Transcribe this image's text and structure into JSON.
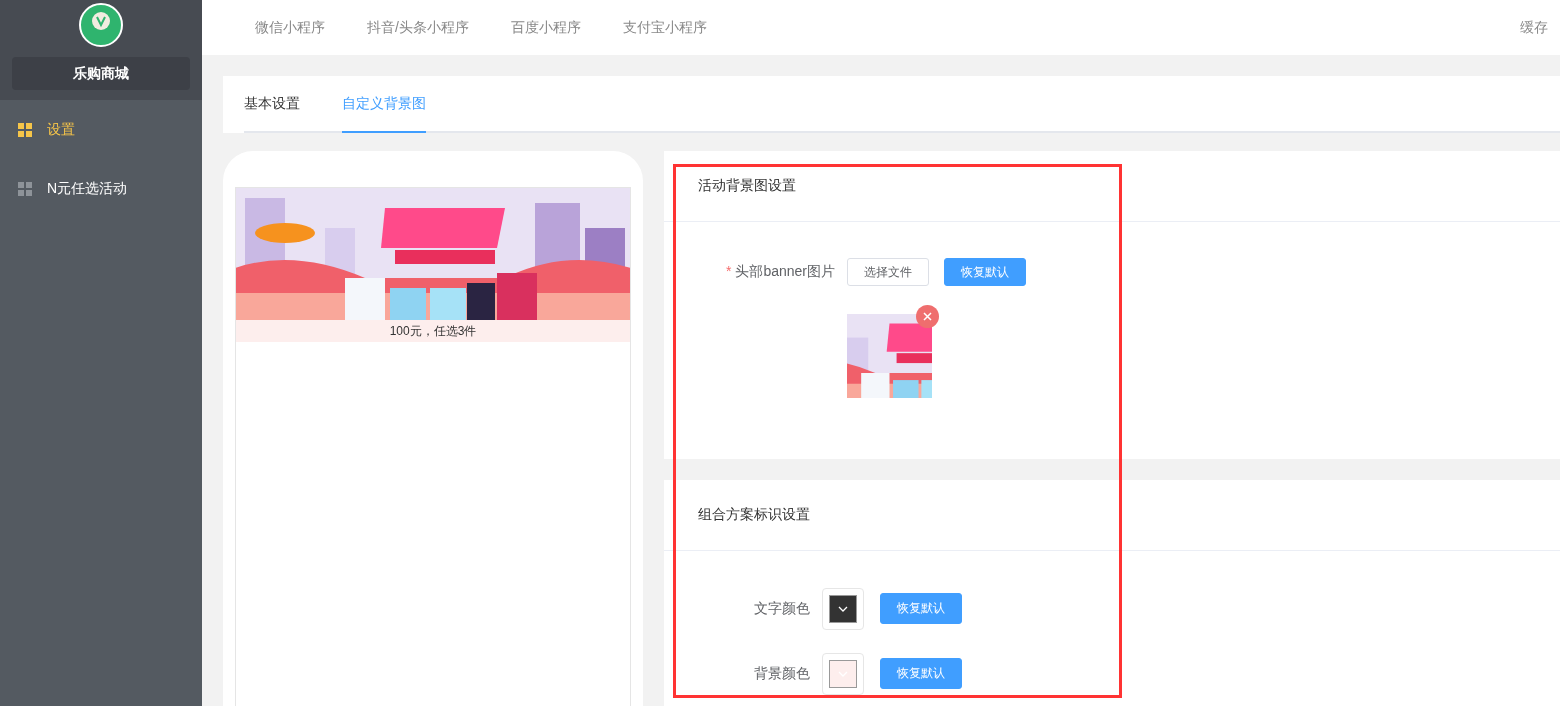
{
  "sidebar": {
    "brand": "乐购商城",
    "items": [
      {
        "label": "设置",
        "selected": true
      },
      {
        "label": "N元任选活动",
        "selected": false
      }
    ]
  },
  "top_nav": {
    "items": [
      "微信小程序",
      "抖音/头条小程序",
      "百度小程序",
      "支付宝小程序"
    ],
    "action": "缓存"
  },
  "tabs": [
    {
      "label": "基本设置",
      "selected": false
    },
    {
      "label": "自定义背景图",
      "selected": true
    }
  ],
  "preview": {
    "caption": "100元，任选3件"
  },
  "sections": [
    {
      "title": "活动背景图设置",
      "fields": [
        {
          "kind": "upload",
          "label": "头部banner图片",
          "required_mark": "*",
          "choose_button": "选择文件",
          "reset_button": "恢复默认"
        }
      ]
    },
    {
      "title": "组合方案标识设置",
      "fields": [
        {
          "kind": "color",
          "label": "文字颜色",
          "color": "#333333",
          "reset_button": "恢复默认"
        },
        {
          "kind": "color",
          "label": "背景颜色",
          "color": "#fdeeed",
          "reset_button": "恢复默认"
        }
      ]
    }
  ]
}
